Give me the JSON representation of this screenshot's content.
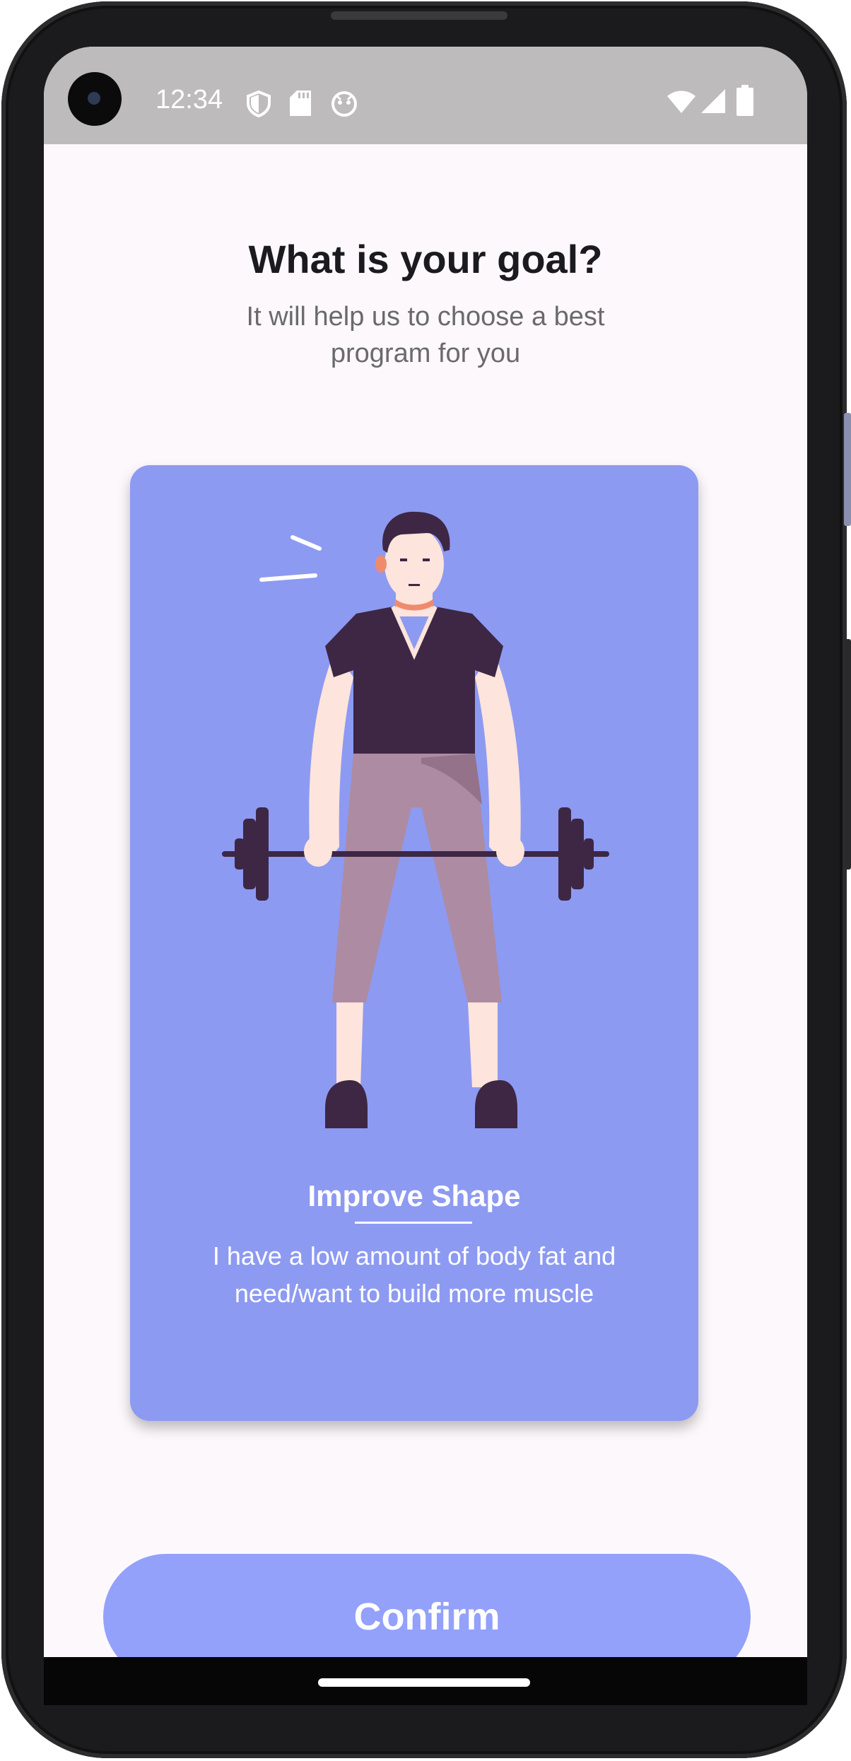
{
  "status_bar": {
    "time": "12:34",
    "left_icons": [
      "shield-icon",
      "sd-card-icon",
      "face-icon"
    ],
    "right_icons": [
      "wifi-icon",
      "signal-icon",
      "battery-icon"
    ]
  },
  "header": {
    "title": "What is your goal?",
    "subtitle": "It will help us to choose a best program for you"
  },
  "goal_card": {
    "title": "Improve Shape",
    "description": "I have a low amount of body fat and need/want to build more muscle",
    "illustration": "man-lifting-barbell",
    "background_color": "#8d9af2"
  },
  "actions": {
    "confirm_label": "Confirm",
    "confirm_color": "#93a1fb"
  }
}
